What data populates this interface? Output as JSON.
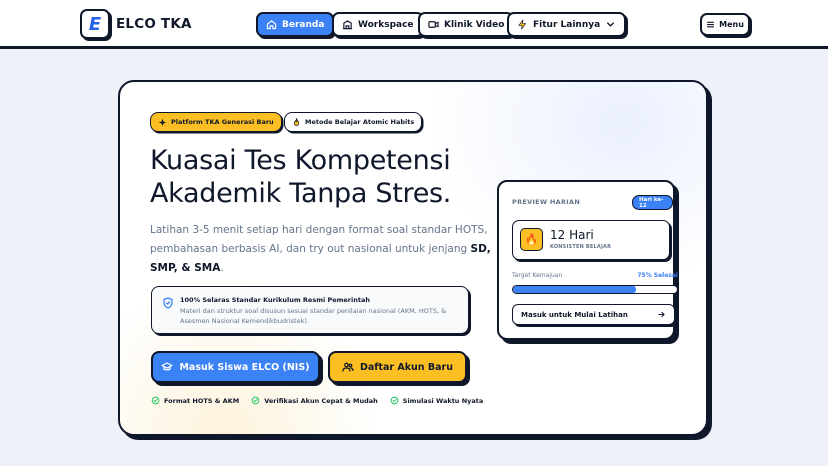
{
  "brand": {
    "logo_letter": "E",
    "name": "ELCO TKA"
  },
  "nav": {
    "items": [
      {
        "label": "Beranda",
        "icon": "home-icon",
        "active": true
      },
      {
        "label": "Workspace",
        "icon": "workspace-icon",
        "active": false
      },
      {
        "label": "Klinik Video",
        "icon": "video-icon",
        "active": false
      },
      {
        "label": "Fitur Lainnya",
        "icon": "bolt-icon",
        "active": false
      }
    ],
    "menu_label": "Menu"
  },
  "hero": {
    "badge_primary": "Platform TKA Generasi Baru",
    "badge_secondary": "Metode Belajar Atomic Habits",
    "headline_line1": "Kuasai Tes Kompetensi",
    "headline_line2": "Akademik Tanpa Stres.",
    "desc_text": "Latihan 3-5 menit setiap hari dengan format soal standar HOTS, pembahasan berbasis AI, dan try out nasional untuk jenjang ",
    "desc_bold": "SD, SMP, & SMA",
    "desc_end": ".",
    "notice_title": "100% Selaras Standar Kurikulum Resmi Pemerintah",
    "notice_body": "Materi dan struktur soal disusun sesuai standar penilaian nasional (AKM, HOTS, & Asesmen Nasional Kemendikbudristek).",
    "cta_login": "Masuk Siswa ELCO (NIS)",
    "cta_register": "Daftar Akun Baru",
    "checks": [
      "Format HOTS & AKM",
      "Verifikasi Akun Cepat & Mudah",
      "Simulasi Waktu Nyata"
    ]
  },
  "preview": {
    "title": "PREVIEW HARIAN",
    "day_badge": "Hari ke-12",
    "streak_value": "12 Hari",
    "streak_label": "KONSISTEN BELAJAR",
    "target_label": "Target Kemajuan",
    "target_value": "75% Selesai",
    "progress": 0.75,
    "button_label": "Masuk untuk Mulai Latihan"
  },
  "colors": {
    "accent_blue": "#3b82f6",
    "accent_yellow": "#fbbf24",
    "ink": "#0f172a",
    "muted": "#64748b"
  }
}
